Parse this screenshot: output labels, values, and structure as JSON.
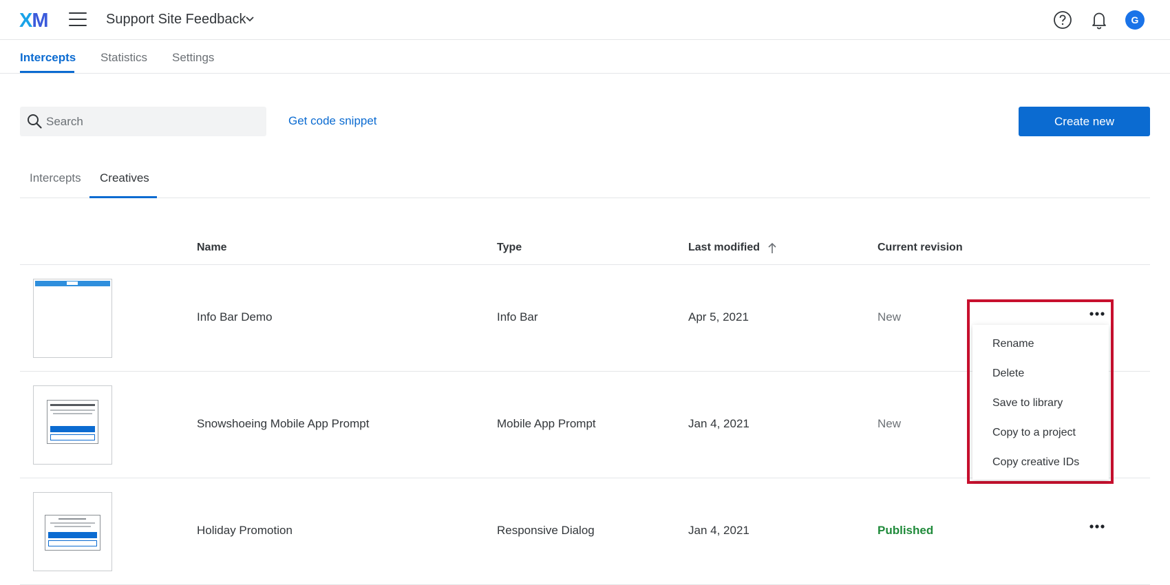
{
  "header": {
    "logo": {
      "x": "X",
      "m": "M"
    },
    "project_name": "Support Site Feedback",
    "avatar_initial": "G",
    "icons": [
      "menu-icon",
      "chevron-down-icon",
      "help-icon",
      "bell-icon"
    ]
  },
  "nav": {
    "tabs": [
      {
        "label": "Intercepts",
        "active": true
      },
      {
        "label": "Statistics",
        "active": false
      },
      {
        "label": "Settings",
        "active": false
      }
    ]
  },
  "toolbar": {
    "search_placeholder": "Search",
    "code_snippet_label": "Get code snippet",
    "create_label": "Create new"
  },
  "subtabs": [
    {
      "label": "Intercepts",
      "active": false
    },
    {
      "label": "Creatives",
      "active": true
    }
  ],
  "table": {
    "columns": [
      "Name",
      "Type",
      "Last modified",
      "Current revision"
    ],
    "rows": [
      {
        "name": "Info Bar Demo",
        "type": "Info Bar",
        "modified": "Apr 5, 2021",
        "revision": "New"
      },
      {
        "name": "Snowshoeing Mobile App Prompt",
        "type": "Mobile App Prompt",
        "modified": "Jan 4, 2021",
        "revision": "New"
      },
      {
        "name": "Holiday Promotion",
        "type": "Responsive Dialog",
        "modified": "Jan 4, 2021",
        "revision": "Published"
      }
    ]
  },
  "context_menu": {
    "items": [
      "Rename",
      "Delete",
      "Save to library",
      "Copy to a project",
      "Copy creative IDs"
    ]
  },
  "colors": {
    "accent": "#0b6bd1",
    "published": "#1f8a3a",
    "highlight": "#c8102e"
  }
}
